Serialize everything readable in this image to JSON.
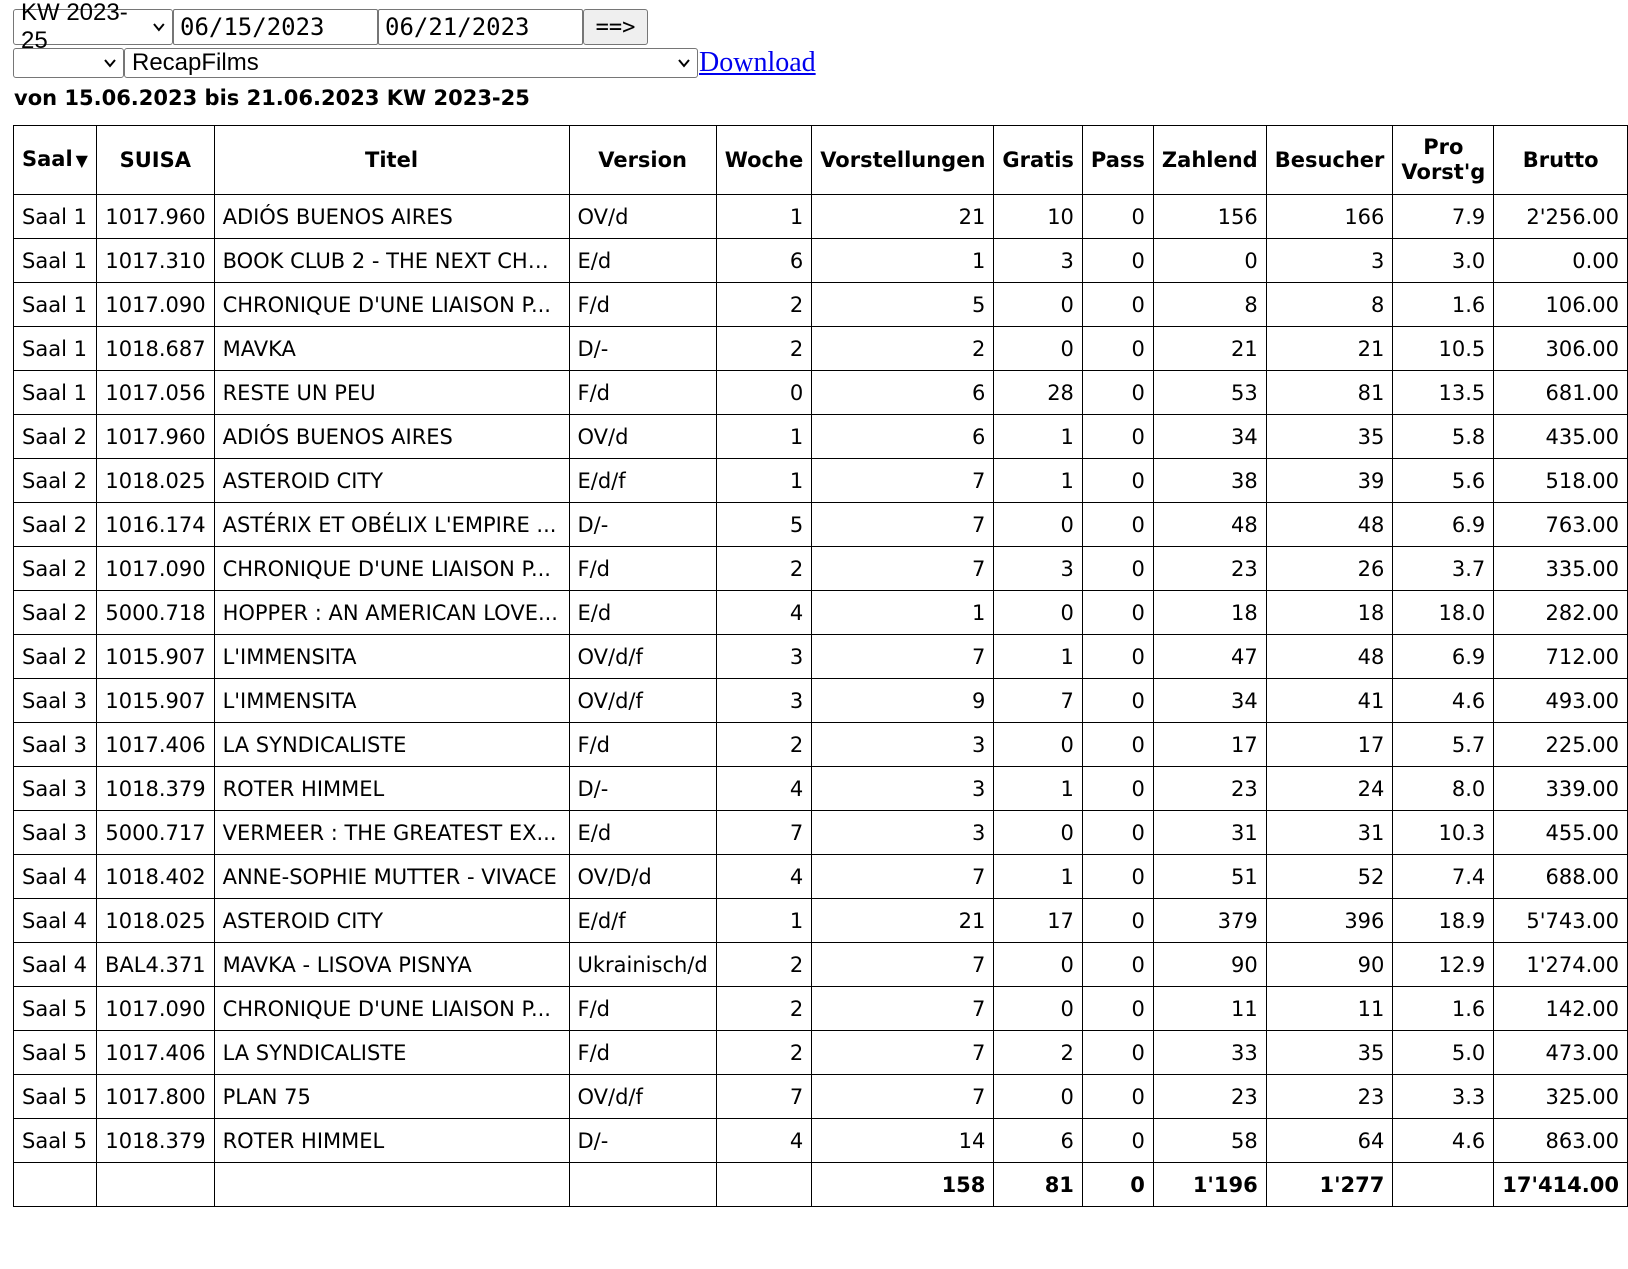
{
  "controls": {
    "week_select": "KW 2023-25",
    "date_from": "06/15/2023",
    "date_to": "06/21/2023",
    "go_button": "==>",
    "filter_select": "",
    "report_select": "RecapFilms",
    "download_link": "Download"
  },
  "range_title": "von 15.06.2023 bis 21.06.2023 KW 2023-25",
  "table": {
    "headers": {
      "saal": "Saal",
      "sort_indicator": "▼",
      "suisa": "SUISA",
      "titel": "Titel",
      "version": "Version",
      "woche": "Woche",
      "vorstellungen": "Vorstellungen",
      "gratis": "Gratis",
      "pass": "Pass",
      "zahlend": "Zahlend",
      "besucher": "Besucher",
      "pro_line1": "Pro",
      "pro_line2": "Vorst'g",
      "brutto": "Brutto"
    },
    "rows": [
      [
        "Saal 1",
        "1017.960",
        "ADIÓS BUENOS AIRES",
        "OV/d",
        "1",
        "21",
        "10",
        "0",
        "156",
        "166",
        "7.9",
        "2'256.00"
      ],
      [
        "Saal 1",
        "1017.310",
        "BOOK CLUB 2 - THE NEXT CHA...",
        "E/d",
        "6",
        "1",
        "3",
        "0",
        "0",
        "3",
        "3.0",
        "0.00"
      ],
      [
        "Saal 1",
        "1017.090",
        "CHRONIQUE D'UNE LIAISON P...",
        "F/d",
        "2",
        "5",
        "0",
        "0",
        "8",
        "8",
        "1.6",
        "106.00"
      ],
      [
        "Saal 1",
        "1018.687",
        "MAVKA",
        "D/-",
        "2",
        "2",
        "0",
        "0",
        "21",
        "21",
        "10.5",
        "306.00"
      ],
      [
        "Saal 1",
        "1017.056",
        "RESTE UN PEU",
        "F/d",
        "0",
        "6",
        "28",
        "0",
        "53",
        "81",
        "13.5",
        "681.00"
      ],
      [
        "Saal 2",
        "1017.960",
        "ADIÓS BUENOS AIRES",
        "OV/d",
        "1",
        "6",
        "1",
        "0",
        "34",
        "35",
        "5.8",
        "435.00"
      ],
      [
        "Saal 2",
        "1018.025",
        "ASTEROID CITY",
        "E/d/f",
        "1",
        "7",
        "1",
        "0",
        "38",
        "39",
        "5.6",
        "518.00"
      ],
      [
        "Saal 2",
        "1016.174",
        "ASTÉRIX ET OBÉLIX L'EMPIRE ...",
        "D/-",
        "5",
        "7",
        "0",
        "0",
        "48",
        "48",
        "6.9",
        "763.00"
      ],
      [
        "Saal 2",
        "1017.090",
        "CHRONIQUE D'UNE LIAISON P...",
        "F/d",
        "2",
        "7",
        "3",
        "0",
        "23",
        "26",
        "3.7",
        "335.00"
      ],
      [
        "Saal 2",
        "5000.718",
        "HOPPER : AN AMERICAN LOVE...",
        "E/d",
        "4",
        "1",
        "0",
        "0",
        "18",
        "18",
        "18.0",
        "282.00"
      ],
      [
        "Saal 2",
        "1015.907",
        "L'IMMENSITA",
        "OV/d/f",
        "3",
        "7",
        "1",
        "0",
        "47",
        "48",
        "6.9",
        "712.00"
      ],
      [
        "Saal 3",
        "1015.907",
        "L'IMMENSITA",
        "OV/d/f",
        "3",
        "9",
        "7",
        "0",
        "34",
        "41",
        "4.6",
        "493.00"
      ],
      [
        "Saal 3",
        "1017.406",
        "LA SYNDICALISTE",
        "F/d",
        "2",
        "3",
        "0",
        "0",
        "17",
        "17",
        "5.7",
        "225.00"
      ],
      [
        "Saal 3",
        "1018.379",
        "ROTER HIMMEL",
        "D/-",
        "4",
        "3",
        "1",
        "0",
        "23",
        "24",
        "8.0",
        "339.00"
      ],
      [
        "Saal 3",
        "5000.717",
        "VERMEER : THE GREATEST EX...",
        "E/d",
        "7",
        "3",
        "0",
        "0",
        "31",
        "31",
        "10.3",
        "455.00"
      ],
      [
        "Saal 4",
        "1018.402",
        "ANNE-SOPHIE MUTTER - VIVACE",
        "OV/D/d",
        "4",
        "7",
        "1",
        "0",
        "51",
        "52",
        "7.4",
        "688.00"
      ],
      [
        "Saal 4",
        "1018.025",
        "ASTEROID CITY",
        "E/d/f",
        "1",
        "21",
        "17",
        "0",
        "379",
        "396",
        "18.9",
        "5'743.00"
      ],
      [
        "Saal 4",
        "BAL4.371",
        "MAVKA - LISOVA PISNYA",
        "Ukrainisch/d",
        "2",
        "7",
        "0",
        "0",
        "90",
        "90",
        "12.9",
        "1'274.00"
      ],
      [
        "Saal 5",
        "1017.090",
        "CHRONIQUE D'UNE LIAISON P...",
        "F/d",
        "2",
        "7",
        "0",
        "0",
        "11",
        "11",
        "1.6",
        "142.00"
      ],
      [
        "Saal 5",
        "1017.406",
        "LA SYNDICALISTE",
        "F/d",
        "2",
        "7",
        "2",
        "0",
        "33",
        "35",
        "5.0",
        "473.00"
      ],
      [
        "Saal 5",
        "1017.800",
        "PLAN 75",
        "OV/d/f",
        "7",
        "7",
        "0",
        "0",
        "23",
        "23",
        "3.3",
        "325.00"
      ],
      [
        "Saal 5",
        "1018.379",
        "ROTER HIMMEL",
        "D/-",
        "4",
        "14",
        "6",
        "0",
        "58",
        "64",
        "4.6",
        "863.00"
      ]
    ],
    "totals": {
      "vorstellungen": "158",
      "gratis": "81",
      "pass": "0",
      "zahlend": "1'196",
      "besucher": "1'277",
      "brutto": "17'414.00"
    }
  }
}
